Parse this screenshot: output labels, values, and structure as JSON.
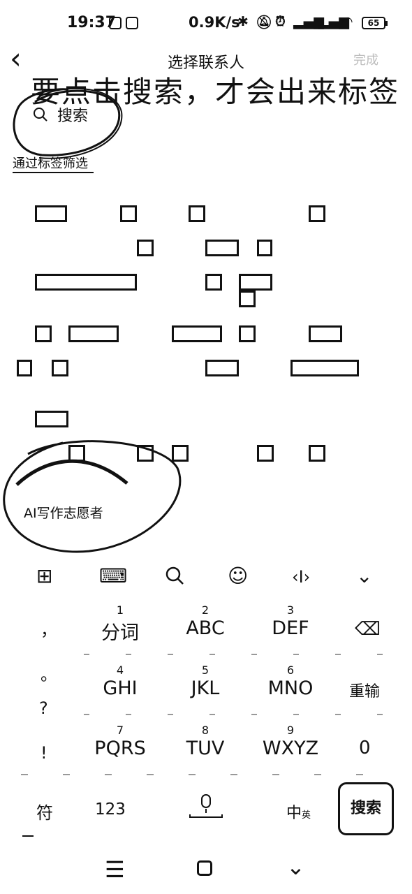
{
  "status_bar": {
    "time": "19:37",
    "network_speed": "0.9K/s",
    "battery": "65"
  },
  "header": {
    "back_icon": "back-chevron-icon",
    "title": "选择联系人",
    "done_label": "完成"
  },
  "annotation": {
    "text": "要点击搜索，才会出来标签"
  },
  "search": {
    "label": "搜索"
  },
  "filter_link": "通过标签筛选",
  "contact_visible_label": "AI写作志愿者",
  "keyboard": {
    "toolbar_icons": [
      "grid-icon",
      "keyboard-icon",
      "search-icon",
      "emoji-icon",
      "cursor-icon",
      "collapse-icon"
    ],
    "rows": [
      {
        "punct": "，",
        "keys": [
          {
            "num": "1",
            "label": "分词"
          },
          {
            "num": "2",
            "label": "ABC"
          },
          {
            "num": "3",
            "label": "DEF"
          }
        ],
        "side": "⌫"
      },
      {
        "punct": "。",
        "keys": [
          {
            "num": "4",
            "label": "GHI"
          },
          {
            "num": "5",
            "label": "JKL"
          },
          {
            "num": "6",
            "label": "MNO"
          }
        ],
        "side": "重输"
      },
      {
        "punct": "?",
        "keys": [
          {
            "num": "7",
            "label": "PQRS"
          },
          {
            "num": "8",
            "label": "TUV"
          },
          {
            "num": "9",
            "label": "WXYZ"
          }
        ],
        "side": "0"
      },
      {
        "punct": "!",
        "keys": [],
        "side": ""
      }
    ],
    "bottom": {
      "symbol": "符",
      "numeric": "123",
      "mic_icon": "microphone-icon",
      "lang": "中",
      "lang_small": "英",
      "action": "搜索"
    }
  },
  "nav_bar": {
    "menu_icon": "menu-icon",
    "home_icon": "home-icon",
    "back_icon": "nav-back-icon"
  }
}
